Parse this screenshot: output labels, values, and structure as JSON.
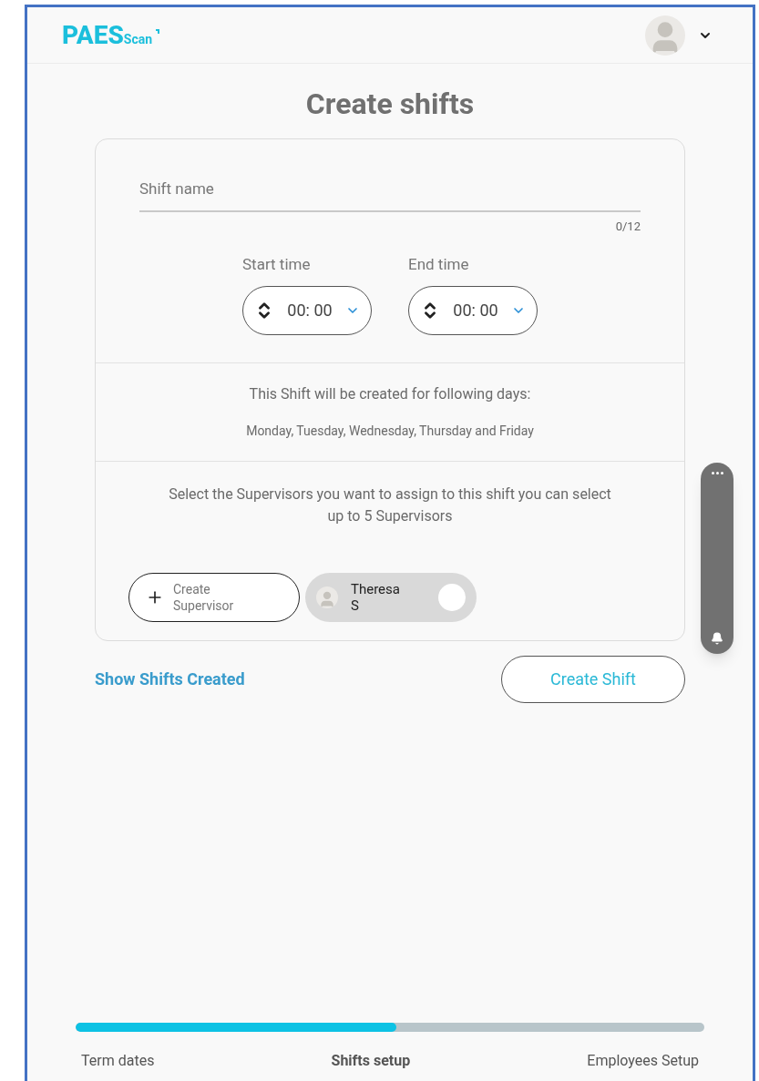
{
  "header": {
    "logo": "PAES",
    "logo_suffix": "Scan"
  },
  "title": "Create shifts",
  "shift_name": {
    "placeholder": "Shift name",
    "counter": "0/12"
  },
  "times": [
    {
      "label": "Start time",
      "value": "00: 00"
    },
    {
      "label": "End time",
      "value": "00: 00"
    }
  ],
  "days_note": "This Shift will be created for following days:",
  "days": "Monday, Tuesday, Wednesday, Thursday and Friday",
  "supervisors_note": "Select the Supervisors you want to assign to this shift you can select up to 5 Supervisors",
  "create_supervisor": "Create Supervisor",
  "supervisors": [
    {
      "name": "Theresa S",
      "selected": false
    }
  ],
  "show_shifts_link": "Show Shifts Created",
  "create_button": "Create Shift",
  "progress": {
    "level": 0.51
  },
  "steps": [
    {
      "label": "Term dates",
      "selected": false
    },
    {
      "label": "Shifts setup",
      "selected": true
    },
    {
      "label": "Employees Setup",
      "selected": false
    }
  ]
}
